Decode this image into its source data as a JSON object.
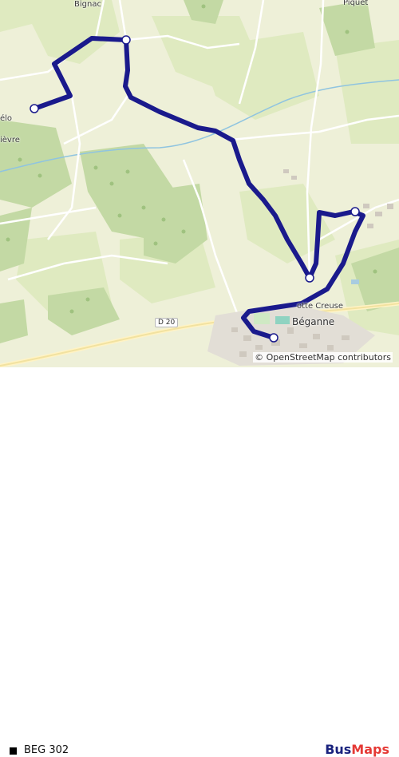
{
  "map": {
    "place_labels": {
      "bignac": "Bignac",
      "piquet": "Piquet",
      "elo": "élo",
      "ievre": "ièvre",
      "motte_creuse": "otte Creuse",
      "beganne": "Béganne"
    },
    "road_ref": "D 20",
    "attribution": "© OpenStreetMap contributors",
    "route_color": "#1a1a8c"
  },
  "legend": {
    "line_name": "BEG 302",
    "swatch_color": "#000000"
  },
  "brand": {
    "part1": "Bus",
    "part2": "Maps",
    "color1": "#1a237e",
    "color2": "#e53935"
  }
}
